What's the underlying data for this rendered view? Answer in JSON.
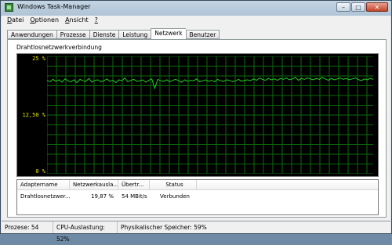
{
  "window": {
    "title": "Windows Task-Manager"
  },
  "caption": {
    "minimize": "–",
    "maximize": "□",
    "close": "✕"
  },
  "menu": [
    {
      "acc": "D",
      "rest": "atei"
    },
    {
      "acc": "O",
      "rest": "ptionen"
    },
    {
      "acc": "A",
      "rest": "nsicht"
    },
    {
      "acc": "?",
      "rest": ""
    }
  ],
  "tabs": [
    "Anwendungen",
    "Prozesse",
    "Dienste",
    "Leistung",
    "Netzwerk",
    "Benutzer"
  ],
  "active_tab": "Netzwerk",
  "graph": {
    "label": "Drahtlosnetzwerkverbindung",
    "y_top": "25 %",
    "y_mid": "12,50 %",
    "y_bottom": "0 %",
    "line_color": "#22d022",
    "grid_color": "#0b6b0b"
  },
  "chart_data": {
    "type": "line",
    "title": "Drahtlosnetzwerkverbindung",
    "ylim": [
      0,
      25
    ],
    "series": [
      {
        "values": [
          19.9,
          19.6,
          20.1,
          19.7,
          20.0,
          19.5,
          20.2,
          19.8,
          19.6,
          20.0,
          19.4,
          20.1,
          19.8,
          19.7,
          20.3,
          19.5,
          19.9,
          20.0,
          19.6,
          19.8,
          20.2,
          19.7,
          19.9,
          19.4,
          20.0,
          19.8,
          20.4,
          19.6,
          19.9,
          20.1,
          19.7,
          19.8,
          20.0,
          19.5,
          19.9,
          20.2,
          18.2,
          20.1,
          19.8,
          19.7,
          20.0,
          19.6,
          19.9,
          20.1,
          19.8,
          19.5,
          20.0,
          19.7,
          19.9,
          19.8,
          20.2,
          19.6,
          19.8,
          20.0,
          19.7,
          19.9,
          19.6,
          20.1,
          19.8,
          19.7,
          20.0,
          19.9,
          19.6,
          19.8,
          20.1,
          19.7,
          19.9,
          20.0,
          19.8,
          20.2,
          19.9,
          20.4,
          20.1,
          19.9,
          20.3,
          20.0,
          20.2,
          19.9,
          20.3,
          20.1,
          20.4,
          20.0,
          20.2,
          20.5,
          19.9,
          20.3,
          20.1,
          20.4,
          20.2,
          20.0,
          20.3,
          20.1,
          20.5,
          20.2,
          19.9,
          20.3,
          20.0,
          20.2,
          20.4,
          20.1,
          20.3,
          20.0,
          20.2,
          20.4,
          20.1,
          19.8,
          20.2,
          20.0,
          20.3,
          20.1
        ]
      }
    ]
  },
  "adapter_table": {
    "headers": [
      "Adaptername",
      "Netzwerkausla...",
      "Übertr...",
      "Status"
    ],
    "rows": [
      [
        "Drahtlosnetzwer...",
        "19,87 %",
        "54 MBit/s",
        "Verbunden"
      ]
    ]
  },
  "status": {
    "processes": "Prozese: 54",
    "cpu": "CPU-Auslastung: 52%",
    "memory": "Physikalischer Speicher: 59%"
  }
}
